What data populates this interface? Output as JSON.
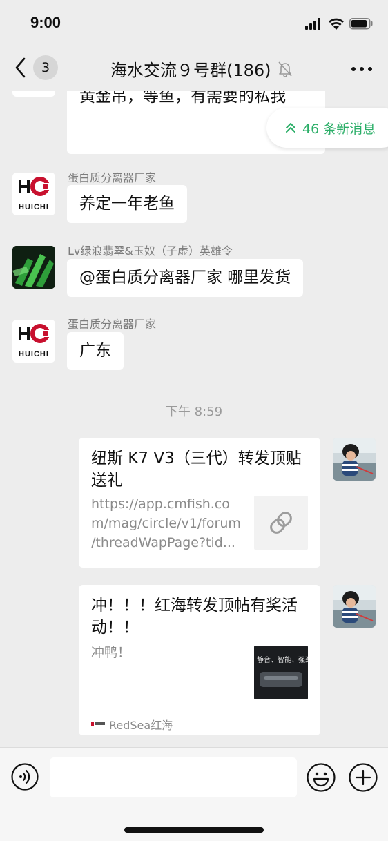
{
  "status_bar": {
    "time": "9:00"
  },
  "nav": {
    "back_count": "3",
    "title": "海水交流９号群(186)"
  },
  "new_messages": {
    "label": "46 条新消息"
  },
  "messages": [
    {
      "text": "有没有需要黄金吊的，吊朋友出黄金吊，等鱼，有需要的私我"
    },
    {
      "sender": "蛋白质分离器厂家",
      "avatar": "HUICHI",
      "text": "养定一年老鱼"
    },
    {
      "sender": "Lv绿浪翡翠&玉奴（子虚）英雄令",
      "text": "@蛋白质分离器厂家  哪里发货"
    },
    {
      "sender": "蛋白质分离器厂家",
      "avatar": "HUICHI",
      "text": "广东"
    }
  ],
  "time_divider": "下午 8:59",
  "cards": [
    {
      "title": "纽斯 K7 V3（三代）转发顶贴送礼",
      "desc_lines": [
        "https://app.cmfish.co",
        "m/mag/circle/v1/forum",
        "/threadWapPage?tid..."
      ],
      "thumb_icon": "link-icon"
    },
    {
      "title": "冲！！！红海转发顶帖有奖活动！！",
      "desc": "冲鸭！",
      "thumb_text": "静音、智能、强劲",
      "source": "RedSea红海"
    }
  ],
  "colors": {
    "accent_green": "#2aae67",
    "background": "#ededed",
    "bubble": "#ffffff"
  }
}
